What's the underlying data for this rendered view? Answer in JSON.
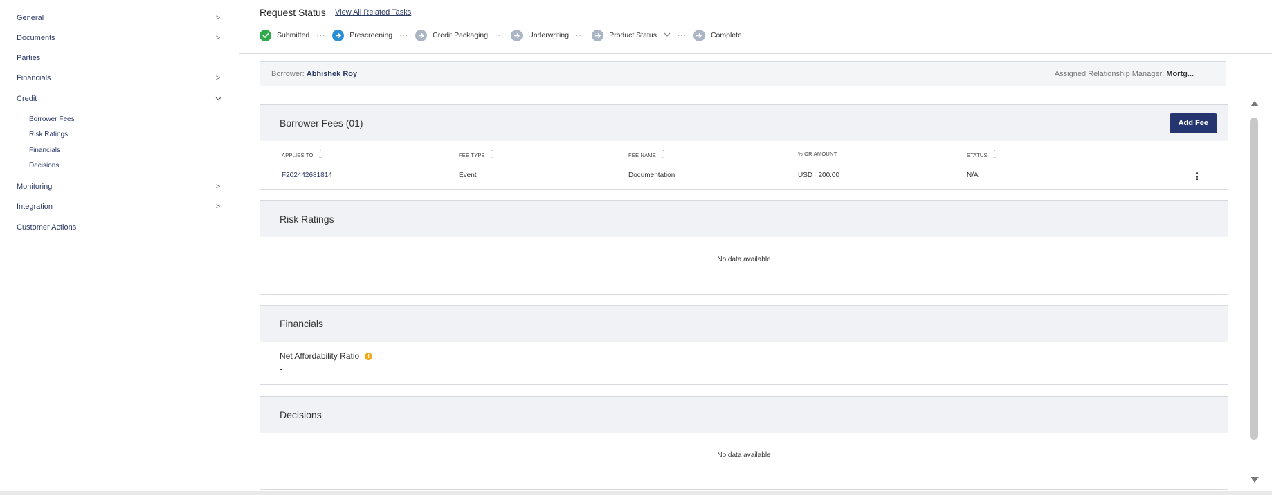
{
  "sidebar": {
    "items": [
      {
        "label": "General"
      },
      {
        "label": "Documents"
      },
      {
        "label": "Parties"
      },
      {
        "label": "Financials"
      },
      {
        "label": "Credit"
      },
      {
        "label": "Monitoring"
      },
      {
        "label": "Integration"
      },
      {
        "label": "Customer Actions"
      }
    ],
    "credit_sub": [
      {
        "label": "Borrower Fees"
      },
      {
        "label": "Risk Ratings"
      },
      {
        "label": "Financials"
      },
      {
        "label": "Decisions"
      }
    ]
  },
  "header": {
    "title": "Request Status",
    "link": "View All Related Tasks",
    "steps": [
      {
        "label": "Submitted",
        "state": "done"
      },
      {
        "label": "Prescreening",
        "state": "active"
      },
      {
        "label": "Credit Packaging",
        "state": "todo"
      },
      {
        "label": "Underwriting",
        "state": "todo"
      },
      {
        "label": "Product Status",
        "state": "todo"
      },
      {
        "label": "Complete",
        "state": "todo"
      }
    ]
  },
  "borrower": {
    "label": "Borrower:",
    "name": "Abhishek Roy",
    "manager_label": "Assigned Relationship Manager:",
    "manager_name": "Mortg..."
  },
  "borrower_fees": {
    "title": "Borrower Fees (01)",
    "add_button": "Add Fee",
    "columns": [
      "APPLIES TO",
      "FEE TYPE",
      "FEE NAME",
      "% OR AMOUNT",
      "STATUS"
    ],
    "rows": [
      {
        "applies_to": "F202442681814",
        "fee_type": "Event",
        "fee_name": "Documentation",
        "amount": "USD   200.00",
        "status": "N/A"
      }
    ]
  },
  "risk_ratings": {
    "title": "Risk Ratings",
    "empty": "No data available"
  },
  "financials": {
    "title": "Financials",
    "metric_label": "Net Affordability Ratio",
    "metric_value": "-",
    "info_glyph": "!"
  },
  "decisions": {
    "title": "Decisions",
    "empty": "No data available"
  },
  "colors": {
    "primary": "#253570",
    "done": "#2faa4a",
    "active": "#2b8fd6",
    "todo": "#aab6c5",
    "info": "#f0a81c"
  }
}
